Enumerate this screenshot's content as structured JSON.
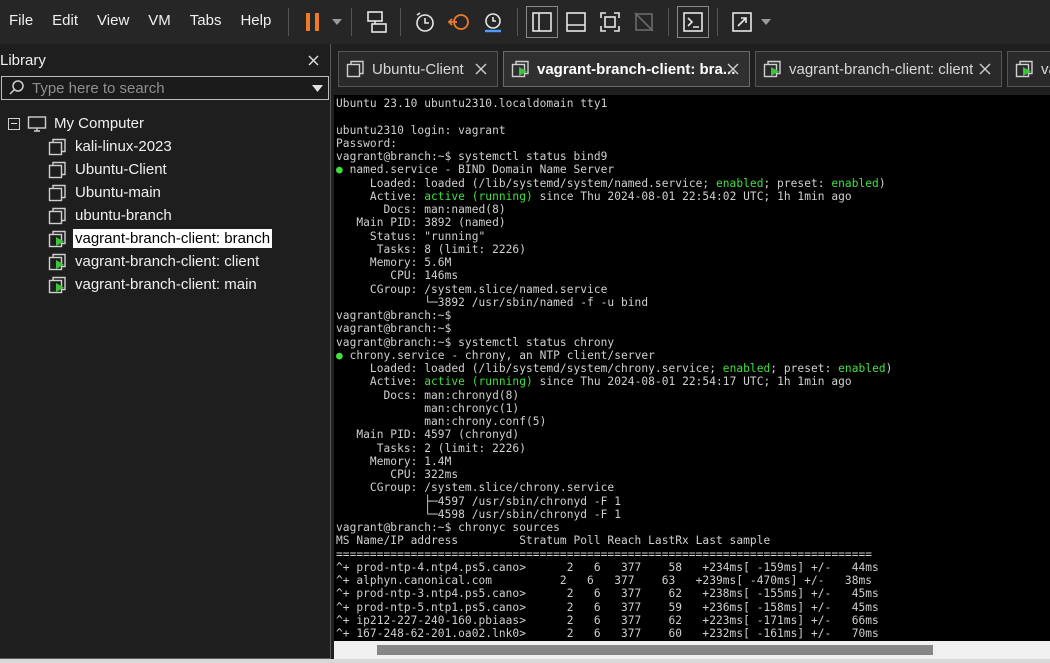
{
  "menubar": {
    "items": [
      "File",
      "Edit",
      "View",
      "VM",
      "Tabs",
      "Help"
    ]
  },
  "toolbar": {
    "icons": [
      "pause-icon",
      "send-keys-icon",
      "snapshot-icon",
      "revert-snapshot-icon",
      "snapshot-manager-icon",
      "library-view-icon",
      "thumbnail-bar-icon",
      "full-screen-icon",
      "unity-icon",
      "console-view-icon",
      "stretch-icon"
    ],
    "accent": "#f07a2a"
  },
  "library": {
    "title": "Library",
    "search_placeholder": "Type here to search",
    "root_label": "My Computer",
    "items": [
      {
        "label": "kali-linux-2023",
        "icon": "vm-icon"
      },
      {
        "label": "Ubuntu-Client",
        "icon": "vm-icon"
      },
      {
        "label": "Ubuntu-main",
        "icon": "vm-icon"
      },
      {
        "label": "ubuntu-branch",
        "icon": "vm-icon"
      },
      {
        "label": "vagrant-branch-client: branch",
        "icon": "vm-running-icon",
        "selected": true
      },
      {
        "label": "vagrant-branch-client: client",
        "icon": "vm-running-icon"
      },
      {
        "label": "vagrant-branch-client: main",
        "icon": "vm-running-icon"
      }
    ]
  },
  "tabs": [
    {
      "label": "Ubuntu-Client",
      "icon": "vm-icon",
      "active": false
    },
    {
      "label": "vagrant-branch-client: bra...",
      "icon": "vm-running-icon",
      "active": true
    },
    {
      "label": "vagrant-branch-client: client",
      "icon": "vm-running-icon",
      "active": false
    },
    {
      "label": "va",
      "icon": "vm-running-icon",
      "active": false
    }
  ],
  "console": {
    "lines": [
      {
        "t": "Ubuntu 23.10 ubuntu2310.localdomain tty1"
      },
      {
        "t": ""
      },
      {
        "t": "ubuntu2310 login: vagrant"
      },
      {
        "t": "Password:"
      },
      {
        "t": "vagrant@branch:~$ systemctl status bind9"
      },
      {
        "segs": [
          {
            "g": "●"
          },
          {
            "t": " named.service - BIND Domain Name Server"
          }
        ]
      },
      {
        "segs": [
          {
            "t": "     Loaded: loaded (/lib/systemd/system/named.service; "
          },
          {
            "g": "enabled"
          },
          {
            "t": "; preset: "
          },
          {
            "g": "enabled"
          },
          {
            "t": ")"
          }
        ]
      },
      {
        "segs": [
          {
            "t": "     Active: "
          },
          {
            "g": "active (running)"
          },
          {
            "t": " since Thu 2024-08-01 22:54:02 UTC; 1h 1min ago"
          }
        ]
      },
      {
        "t": "       Docs: man:named(8)"
      },
      {
        "t": "   Main PID: 3892 (named)"
      },
      {
        "t": "     Status: \"running\""
      },
      {
        "t": "      Tasks: 8 (limit: 2226)"
      },
      {
        "t": "     Memory: 5.6M"
      },
      {
        "t": "        CPU: 146ms"
      },
      {
        "t": "     CGroup: /system.slice/named.service"
      },
      {
        "t": "             └─3892 /usr/sbin/named -f -u bind"
      },
      {
        "t": "vagrant@branch:~$"
      },
      {
        "t": "vagrant@branch:~$"
      },
      {
        "t": "vagrant@branch:~$ systemctl status chrony"
      },
      {
        "segs": [
          {
            "g": "●"
          },
          {
            "t": " chrony.service - chrony, an NTP client/server"
          }
        ]
      },
      {
        "segs": [
          {
            "t": "     Loaded: loaded (/lib/systemd/system/chrony.service; "
          },
          {
            "g": "enabled"
          },
          {
            "t": "; preset: "
          },
          {
            "g": "enabled"
          },
          {
            "t": ")"
          }
        ]
      },
      {
        "segs": [
          {
            "t": "     Active: "
          },
          {
            "g": "active (running)"
          },
          {
            "t": " since Thu 2024-08-01 22:54:17 UTC; 1h 1min ago"
          }
        ]
      },
      {
        "t": "       Docs: man:chronyd(8)"
      },
      {
        "t": "             man:chronyc(1)"
      },
      {
        "t": "             man:chrony.conf(5)"
      },
      {
        "t": "   Main PID: 4597 (chronyd)"
      },
      {
        "t": "      Tasks: 2 (limit: 2226)"
      },
      {
        "t": "     Memory: 1.4M"
      },
      {
        "t": "        CPU: 322ms"
      },
      {
        "t": "     CGroup: /system.slice/chrony.service"
      },
      {
        "t": "             ├─4597 /usr/sbin/chronyd -F 1"
      },
      {
        "t": "             └─4598 /usr/sbin/chronyd -F 1"
      },
      {
        "t": "vagrant@branch:~$ chronyc sources"
      },
      {
        "t": "MS Name/IP address         Stratum Poll Reach LastRx Last sample"
      },
      {
        "t": "==============================================================================="
      },
      {
        "t": "^+ prod-ntp-4.ntp4.ps5.cano>      2   6   377    58   +234ms[ -159ms] +/-   44ms"
      },
      {
        "t": "^+ alphyn.canonical.com          2   6   377    63   +239ms[ -470ms] +/-   38ms"
      },
      {
        "t": "^+ prod-ntp-3.ntp4.ps5.cano>      2   6   377    62   +238ms[ -155ms] +/-   45ms"
      },
      {
        "t": "^+ prod-ntp-5.ntp1.ps5.cano>      2   6   377    59   +236ms[ -158ms] +/-   45ms"
      },
      {
        "t": "^+ ip212-227-240-160.pbiaas>      2   6   377    62   +223ms[ -171ms] +/-   66ms"
      },
      {
        "t": "^+ 167-248-62-201.oa02.lnk0>      2   6   377    60   +232ms[ -161ms] +/-   70ms"
      }
    ]
  },
  "scrollbar": {
    "position": 0.03,
    "visible_fraction": 0.83
  }
}
